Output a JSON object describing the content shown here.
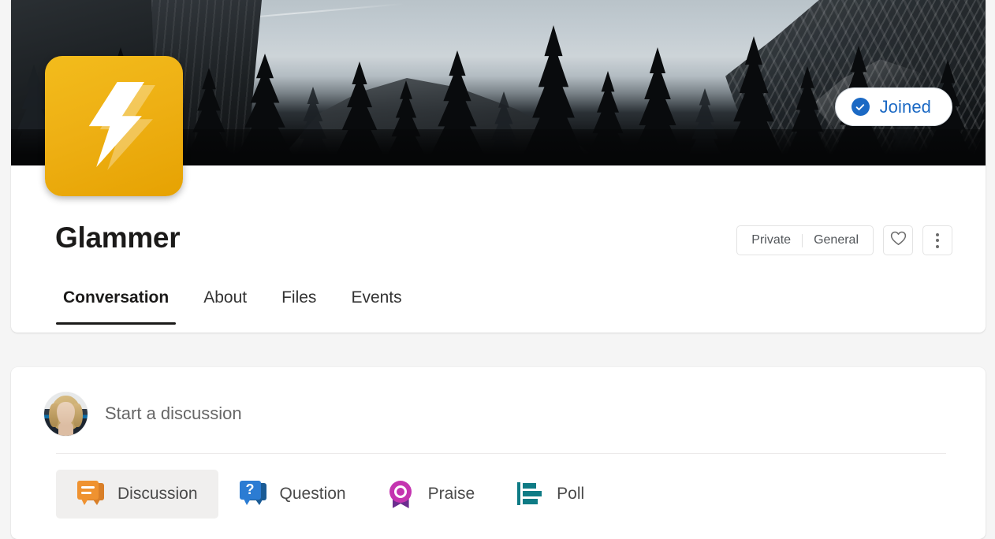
{
  "group": {
    "name": "Glammer",
    "logo_icon": "lightning-bolt-icon",
    "logo_color": "#eeb014",
    "cover_photo_alt": "snowy pine forest and mountain cliff"
  },
  "join_button": {
    "label": "Joined",
    "icon": "check-circle-icon",
    "color": "#1b69c4"
  },
  "meta": {
    "privacy": "Private",
    "classification": "General",
    "favorite_icon": "heart-icon",
    "more_icon": "more-vertical-icon"
  },
  "tabs": [
    {
      "label": "Conversation",
      "active": true
    },
    {
      "label": "About",
      "active": false
    },
    {
      "label": "Files",
      "active": false
    },
    {
      "label": "Events",
      "active": false
    }
  ],
  "composer": {
    "avatar_icon": "user-avatar",
    "placeholder": "Start a discussion",
    "post_types": [
      {
        "label": "Discussion",
        "icon": "discussion-bubble-icon",
        "color": "#ef9230",
        "selected": true
      },
      {
        "label": "Question",
        "icon": "question-bubble-icon",
        "color": "#2b7cd3",
        "selected": false
      },
      {
        "label": "Praise",
        "icon": "praise-medal-icon",
        "color": "#c434b0",
        "selected": false
      },
      {
        "label": "Poll",
        "icon": "poll-bars-icon",
        "color": "#0e7b85",
        "selected": false
      }
    ]
  }
}
